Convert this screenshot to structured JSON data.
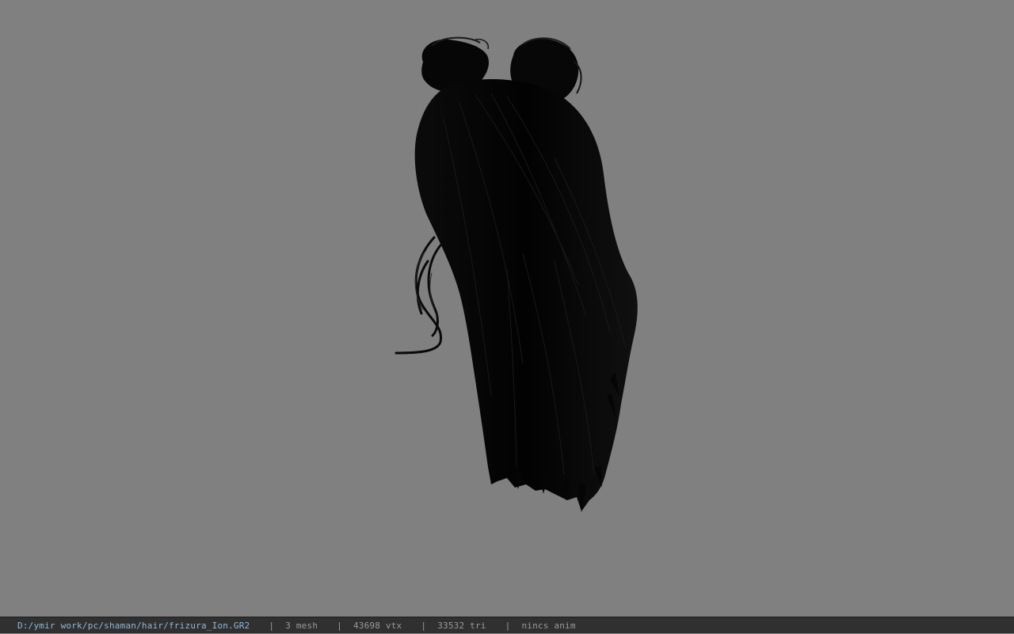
{
  "viewport": {
    "background_color": "#808080",
    "model_color": "#050505"
  },
  "status_bar": {
    "file_path": "D:/ymir work/pc/shaman/hair/frizura_Ion.GR2",
    "separator": "|",
    "mesh_count": "3 mesh",
    "vertex_count": "43698 vtx",
    "triangle_count": "33532 tri",
    "anim_status": "nincs anim"
  }
}
